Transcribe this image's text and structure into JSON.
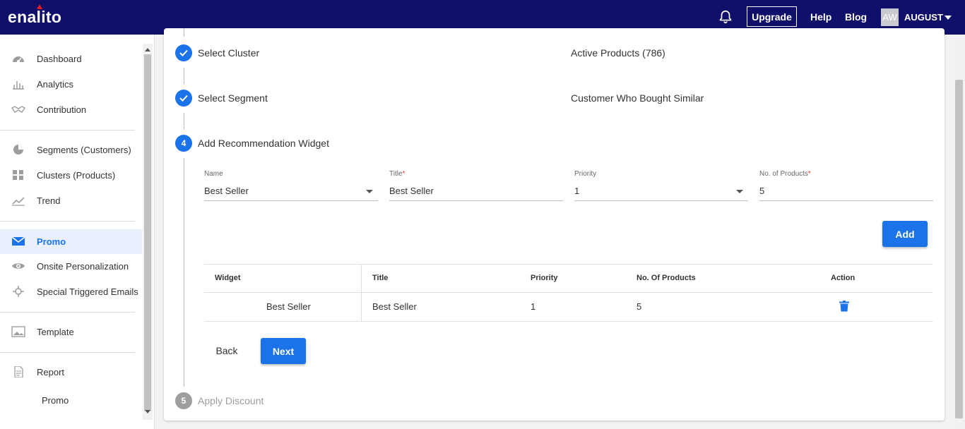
{
  "header": {
    "logo": "enalito",
    "upgrade_label": "Upgrade",
    "help_label": "Help",
    "blog_label": "Blog",
    "avatar_initials": "AW",
    "username": "AUGUST"
  },
  "sidebar": {
    "groups": [
      [
        {
          "label": "Dashboard",
          "icon": "dashboard-icon"
        },
        {
          "label": "Analytics",
          "icon": "bar-chart-icon"
        },
        {
          "label": "Contribution",
          "icon": "handshake-icon"
        }
      ],
      [
        {
          "label": "Segments (Customers)",
          "icon": "pie-chart-icon"
        },
        {
          "label": "Clusters (Products)",
          "icon": "grid-icon"
        },
        {
          "label": "Trend",
          "icon": "trend-icon"
        }
      ],
      [
        {
          "label": "Promo",
          "icon": "mail-icon",
          "active": true
        },
        {
          "label": "Onsite Personalization",
          "icon": "eye-icon"
        },
        {
          "label": "Special Triggered Emails",
          "icon": "crosshair-icon"
        }
      ],
      [
        {
          "label": "Template",
          "icon": "image-icon"
        }
      ],
      [
        {
          "label": "Report",
          "icon": "document-icon"
        }
      ]
    ],
    "sub_item": "Promo"
  },
  "stepper": {
    "step1": {
      "label": "Select Cluster",
      "summary": "Active Products (786)"
    },
    "step2": {
      "label": "Select Segment",
      "summary": "Customer Who Bought Similar"
    },
    "step4": {
      "number": "4",
      "label": "Add Recommendation Widget"
    },
    "step5": {
      "number": "5",
      "label": "Apply Discount"
    }
  },
  "form": {
    "name": {
      "label": "Name",
      "value": "Best Seller"
    },
    "title": {
      "label": "Title",
      "required_mark": "*",
      "value": "Best Seller"
    },
    "priority": {
      "label": "Priority",
      "value": "1"
    },
    "num_products": {
      "label": "No. of Products",
      "required_mark": "*",
      "value": "5"
    },
    "add_label": "Add"
  },
  "table": {
    "headers": [
      "Widget",
      "Title",
      "Priority",
      "No. Of Products",
      "Action"
    ],
    "rows": [
      {
        "widget": "Best Seller",
        "title": "Best Seller",
        "priority": "1",
        "num_products": "5"
      }
    ]
  },
  "actions": {
    "back_label": "Back",
    "next_label": "Next"
  },
  "colors": {
    "topbar": "#10106b",
    "primary": "#1a73e8",
    "logo_accent": "#e21b1b"
  }
}
